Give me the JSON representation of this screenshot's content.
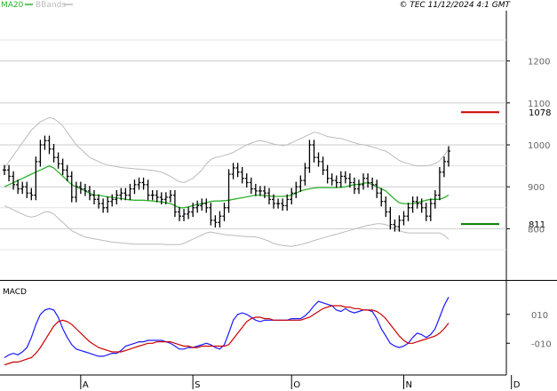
{
  "header": {
    "legend_ma20": "MA20",
    "legend_bbands": "BBands",
    "copyright": "© TEC 11/12/2024 4:1 GMT"
  },
  "colors": {
    "ma20": "#2db22d",
    "bbands": "#bbbbbb",
    "price_bars": "#000000",
    "resistance": "#cc0000",
    "support": "#008000",
    "macd_line": "#1a1aff",
    "signal_line": "#cc0000",
    "grid": "#cccccc"
  },
  "chart_data": [
    {
      "type": "line",
      "subtype": "ohlc",
      "title": "",
      "y_ticks": [
        "1200",
        "1100",
        "1000",
        "900",
        "800"
      ],
      "y_tick_values": [
        1200,
        1100,
        1000,
        900,
        800
      ],
      "ylim": [
        680,
        1320
      ],
      "grid": true,
      "x_tick_labels": [
        "A",
        "S",
        "O",
        "N",
        "D"
      ],
      "x_tick_index": [
        17,
        42,
        64,
        89,
        113
      ],
      "levels": [
        {
          "label": "1078",
          "value": 1078,
          "color": "#cc0000"
        },
        {
          "label": "811",
          "value": 811,
          "color": "#008000"
        }
      ],
      "close": [
        940,
        925,
        905,
        895,
        900,
        885,
        880,
        960,
        1000,
        1010,
        990,
        970,
        955,
        940,
        925,
        875,
        900,
        895,
        890,
        880,
        870,
        860,
        850,
        865,
        870,
        880,
        885,
        880,
        895,
        905,
        910,
        905,
        880,
        880,
        875,
        870,
        875,
        880,
        840,
        830,
        835,
        840,
        850,
        855,
        860,
        850,
        820,
        815,
        830,
        850,
        930,
        945,
        935,
        920,
        910,
        895,
        890,
        890,
        885,
        870,
        860,
        860,
        855,
        870,
        885,
        900,
        915,
        945,
        1000,
        970,
        960,
        940,
        920,
        915,
        910,
        925,
        920,
        910,
        895,
        905,
        920,
        910,
        905,
        885,
        865,
        840,
        810,
        805,
        820,
        830,
        850,
        865,
        860,
        850,
        830,
        860,
        880,
        935,
        960,
        985
      ],
      "series": [
        {
          "name": "MA20",
          "values": [
            900,
            905,
            910,
            915,
            920,
            925,
            930,
            935,
            940,
            945,
            950,
            945,
            935,
            925,
            915,
            905,
            900,
            895,
            890,
            885,
            880,
            880,
            878,
            876,
            875,
            873,
            872,
            870,
            869,
            868,
            868,
            868,
            867,
            866,
            865,
            864,
            862,
            860,
            855,
            850,
            850,
            852,
            855,
            858,
            860,
            862,
            865,
            866,
            866,
            867,
            868,
            870,
            872,
            874,
            876,
            878,
            880,
            880,
            879,
            878,
            877,
            877,
            877,
            878,
            880,
            885,
            890,
            893,
            895,
            897,
            898,
            898,
            898,
            898,
            898,
            899,
            900,
            903,
            905,
            906,
            908,
            910,
            905,
            900,
            895,
            890,
            880,
            870,
            862,
            860,
            860,
            860,
            862,
            865,
            868,
            870,
            870,
            870,
            874,
            880
          ]
        },
        {
          "name": "BBands",
          "values_upper": [
            945,
            960,
            975,
            990,
            1005,
            1020,
            1035,
            1045,
            1055,
            1060,
            1065,
            1062,
            1055,
            1045,
            1030,
            1015,
            1000,
            990,
            980,
            970,
            965,
            960,
            955,
            952,
            950,
            948,
            946,
            945,
            944,
            943,
            942,
            941,
            940,
            939,
            937,
            935,
            930,
            925,
            918,
            912,
            910,
            915,
            920,
            930,
            940,
            955,
            965,
            970,
            972,
            975,
            978,
            982,
            988,
            994,
            1000,
            1004,
            1008,
            1010,
            1008,
            1005,
            1002,
            1000,
            998,
            1000,
            1005,
            1010,
            1015,
            1020,
            1025,
            1030,
            1028,
            1024,
            1020,
            1018,
            1016,
            1015,
            1012,
            1008,
            1005,
            1002,
            1000,
            998,
            995,
            992,
            988,
            985,
            978,
            970,
            963,
            958,
            955,
            952,
            950,
            950,
            950,
            952,
            955,
            962,
            975,
            990
          ],
          "values_lower": [
            855,
            850,
            845,
            840,
            835,
            830,
            828,
            830,
            835,
            840,
            840,
            835,
            825,
            815,
            805,
            795,
            790,
            785,
            780,
            778,
            776,
            774,
            772,
            770,
            768,
            767,
            766,
            765,
            764,
            763,
            763,
            763,
            763,
            763,
            763,
            763,
            762,
            762,
            762,
            762,
            765,
            770,
            775,
            780,
            785,
            790,
            792,
            790,
            788,
            786,
            785,
            784,
            783,
            782,
            781,
            781,
            780,
            778,
            774,
            770,
            765,
            762,
            760,
            759,
            758,
            760,
            762,
            765,
            768,
            772,
            775,
            778,
            781,
            784,
            787,
            790,
            793,
            796,
            799,
            802,
            805,
            808,
            810,
            812,
            812,
            810,
            805,
            800,
            795,
            792,
            790,
            790,
            790,
            790,
            790,
            790,
            790,
            790,
            785,
            775
          ]
        }
      ]
    },
    {
      "type": "line",
      "title": "MACD",
      "y_ticks": [
        "010",
        "-010"
      ],
      "y_tick_values": [
        10,
        -10
      ],
      "ylim": [
        -32,
        32
      ],
      "grid": false,
      "series": [
        {
          "name": "MACD",
          "values": [
            -20,
            -18,
            -17,
            -18,
            -16,
            -13,
            -6,
            3,
            10,
            13,
            14,
            13,
            8,
            0,
            -6,
            -11,
            -14,
            -15,
            -16,
            -17,
            -18,
            -19,
            -19,
            -18,
            -17,
            -17,
            -15,
            -12,
            -11,
            -10,
            -9,
            -9,
            -8,
            -8,
            -8,
            -8,
            -9,
            -10,
            -12,
            -14,
            -14,
            -13,
            -13,
            -12,
            -11,
            -10,
            -11,
            -13,
            -14,
            -11,
            -3,
            6,
            10,
            11,
            10,
            8,
            6,
            5,
            6,
            6,
            6,
            6,
            6,
            6,
            7,
            7,
            7,
            9,
            12,
            16,
            19,
            18,
            17,
            16,
            13,
            12,
            14,
            12,
            11,
            12,
            13,
            13,
            12,
            7,
            0,
            -5,
            -10,
            -12,
            -13,
            -12,
            -10,
            -6,
            -3,
            -4,
            -6,
            -4,
            0,
            8,
            16,
            22
          ]
        },
        {
          "name": "Signal",
          "values": [
            -25,
            -24,
            -23,
            -23,
            -22,
            -21,
            -20,
            -17,
            -13,
            -8,
            -3,
            2,
            5,
            6,
            5,
            3,
            0,
            -3,
            -6,
            -9,
            -11,
            -13,
            -14,
            -15,
            -16,
            -16,
            -16,
            -15,
            -14,
            -13,
            -12,
            -11,
            -10,
            -10,
            -9,
            -9,
            -9,
            -9,
            -10,
            -11,
            -12,
            -12,
            -13,
            -13,
            -12,
            -12,
            -12,
            -12,
            -12,
            -12,
            -11,
            -7,
            -3,
            1,
            5,
            7,
            8,
            8,
            7,
            7,
            6,
            6,
            6,
            6,
            6,
            6,
            6,
            7,
            8,
            10,
            12,
            14,
            15,
            16,
            16,
            16,
            15,
            15,
            14,
            14,
            13,
            13,
            13,
            12,
            10,
            7,
            3,
            -1,
            -5,
            -8,
            -10,
            -10,
            -9,
            -8,
            -7,
            -6,
            -5,
            -3,
            0,
            4
          ]
        }
      ]
    }
  ]
}
